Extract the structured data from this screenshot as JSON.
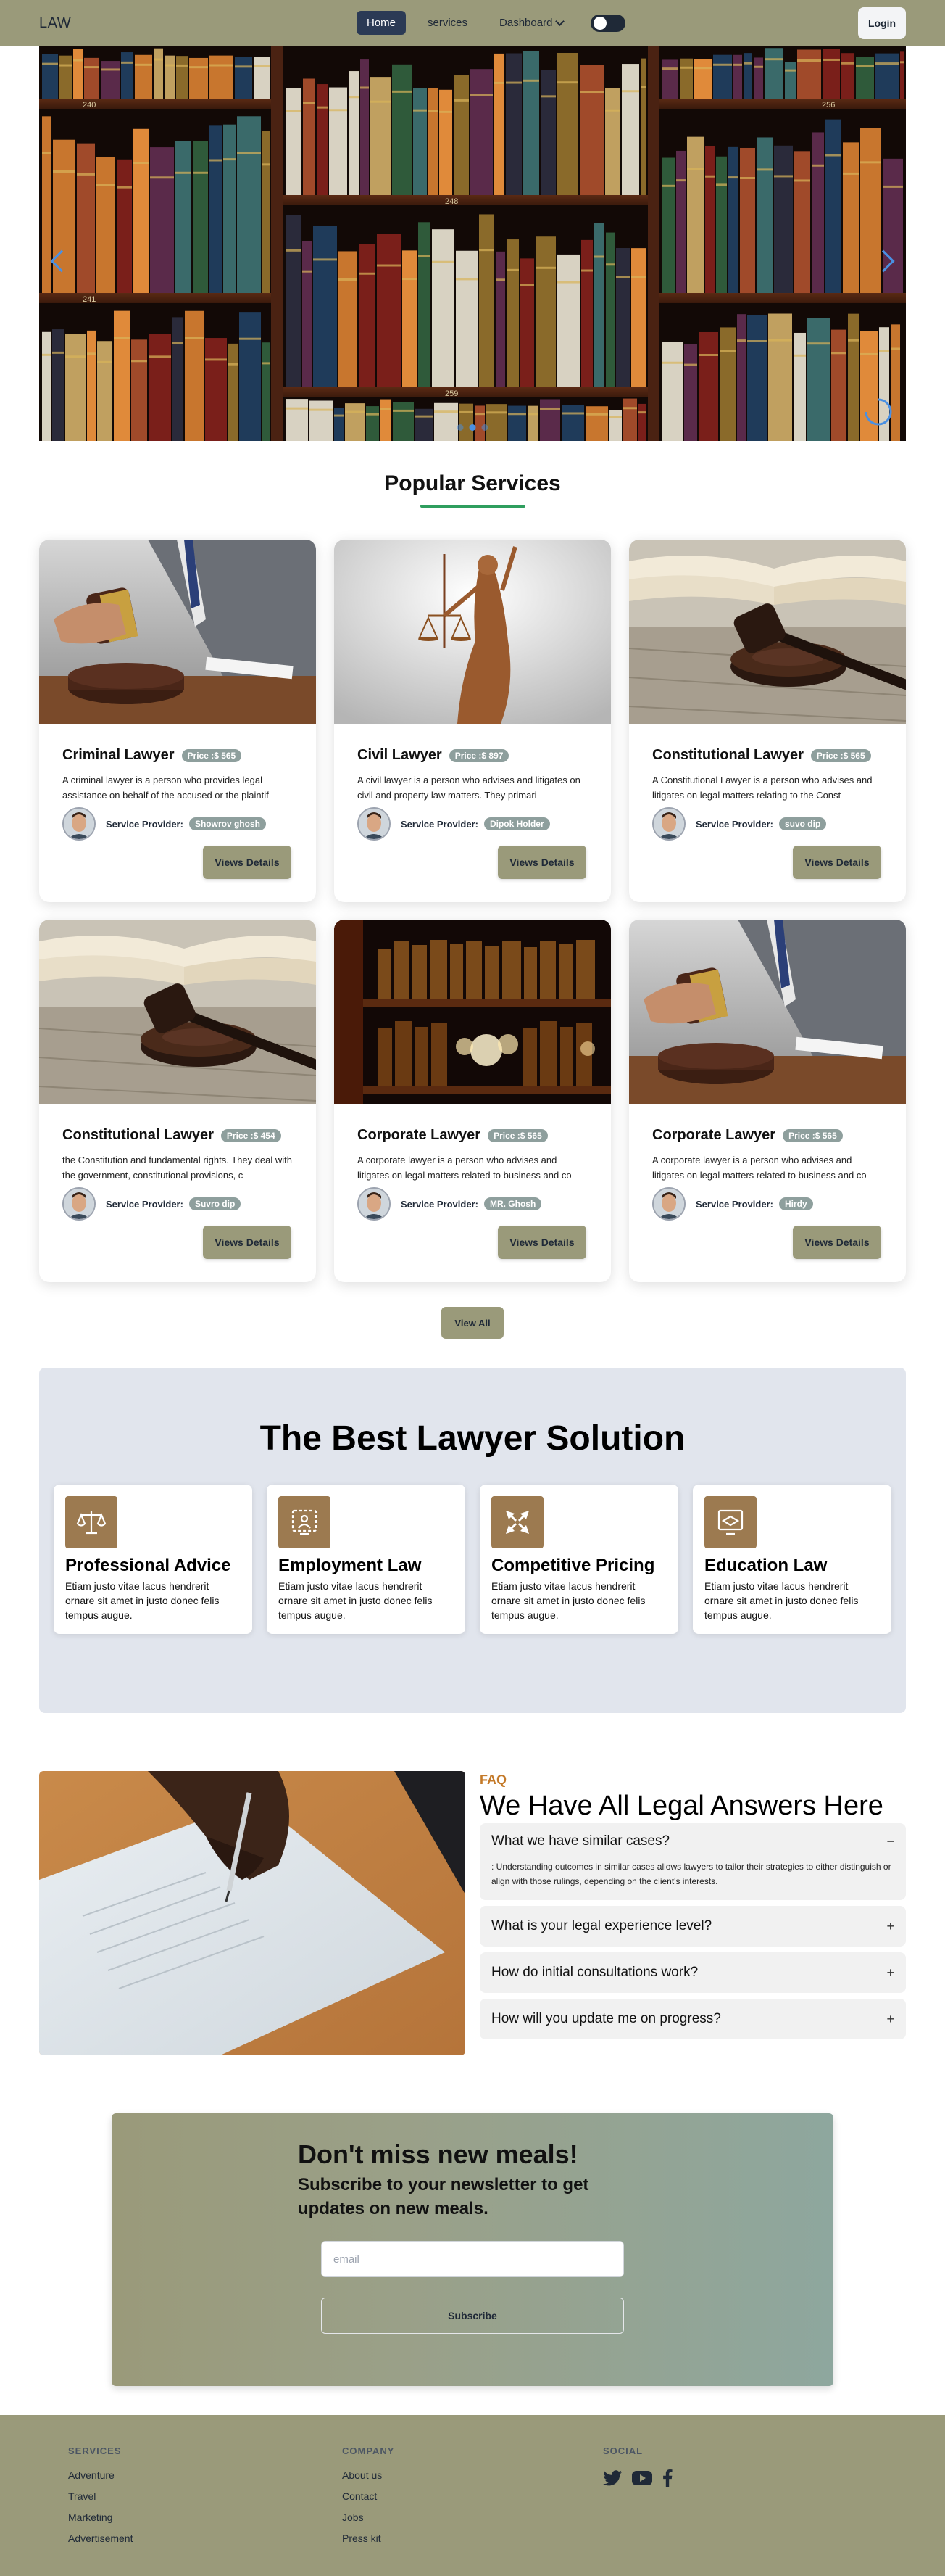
{
  "nav": {
    "brand": "LAW",
    "links": [
      "Home",
      "services"
    ],
    "dropdown": "Dashboard",
    "login": "Login"
  },
  "hero": {
    "shelf_labels": [
      "240",
      "241",
      "248",
      "256",
      "259"
    ],
    "slide_count": 3,
    "active_slide": 2
  },
  "popular": {
    "title": "Popular Services",
    "provider_label": "Service Provider:",
    "button": "Views Details",
    "cards": [
      {
        "title": "Criminal Lawyer",
        "price": "Price :$ 565",
        "desc": "A criminal lawyer is a person who provides legal assistance on behalf of the accused or the plaintif",
        "provider": "Showrov ghosh",
        "image": "gavel-hand"
      },
      {
        "title": "Civil Lawyer",
        "price": "Price :$ 897",
        "desc": "A civil lawyer is a person who advises and litigates on civil and property law matters. They primari",
        "provider": "Dipok Holder",
        "image": "lady-justice"
      },
      {
        "title": "Constitutional Lawyer",
        "price": "Price :$ 565",
        "desc": "A Constitutional Lawyer is a person who advises and litigates on legal matters relating to the Const",
        "provider": "suvo dip",
        "image": "gavel-books"
      },
      {
        "title": "Constitutional Lawyer",
        "price": "Price :$ 454",
        "desc": "the Constitution and fundamental rights. They deal with the government, constitutional provisions, c",
        "provider": "Suvro dip",
        "image": "gavel-books"
      },
      {
        "title": "Corporate Lawyer",
        "price": "Price :$ 565",
        "desc": "A corporate lawyer is a person who advises and litigates on legal matters related to business and co",
        "provider": "MR. Ghosh",
        "image": "bookshelf"
      },
      {
        "title": "Corporate Lawyer",
        "price": "Price :$ 565",
        "desc": "A corporate lawyer is a person who advises and litigates on legal matters related to business and co",
        "provider": "Hirdy",
        "image": "gavel-hand"
      }
    ],
    "view_all": "View All"
  },
  "best": {
    "title": "The Best Lawyer Solution",
    "features": [
      {
        "title": "Professional Advice",
        "text": "Etiam justo vitae lacus hendrerit ornare sit amet in justo donec felis tempus augue.",
        "icon": "scales-icon"
      },
      {
        "title": "Employment Law",
        "text": "Etiam justo vitae lacus hendrerit ornare sit amet in justo donec felis tempus augue.",
        "icon": "employment-icon"
      },
      {
        "title": "Competitive Pricing",
        "text": "Etiam justo vitae lacus hendrerit ornare sit amet in justo donec felis tempus augue.",
        "icon": "pricing-icon"
      },
      {
        "title": "Education Law",
        "text": "Etiam justo vitae lacus hendrerit ornare sit amet in justo donec felis tempus augue.",
        "icon": "education-icon"
      }
    ]
  },
  "faq": {
    "kicker": "FAQ",
    "title": "We Have All Legal Answers Here",
    "items": [
      {
        "q": "What we have similar cases?",
        "sign": "−",
        "answer": ": Understanding outcomes in similar cases allows lawyers to tailor their strategies to either distinguish or align with those rulings, depending on the client's interests."
      },
      {
        "q": "What is your legal experience level?",
        "sign": "+"
      },
      {
        "q": "How do initial consultations work?",
        "sign": "+"
      },
      {
        "q": "How will you update me on progress?",
        "sign": "+"
      }
    ]
  },
  "newsletter": {
    "title": "Don't miss new meals!",
    "subtitle": "Subscribe to your newsletter to get updates on new meals.",
    "placeholder": "email",
    "button": "Subscribe"
  },
  "footer": {
    "services": {
      "heading": "SERVICES",
      "links": [
        "Adventure",
        "Travel",
        "Marketing",
        "Advertisement"
      ]
    },
    "company": {
      "heading": "COMPANY",
      "links": [
        "About us",
        "Contact",
        "Jobs",
        "Press kit"
      ]
    },
    "social": {
      "heading": "SOCIAL",
      "icons": [
        "twitter-icon",
        "youtube-icon",
        "facebook-icon"
      ]
    }
  },
  "colors": {
    "olive": "#9a9a7a",
    "navy": "#2b3a55",
    "badge": "#8e9f9d",
    "accent_green": "#2f9e5e",
    "feature_icon_bg": "#9c7a50",
    "faq_kicker": "#c47a2a"
  }
}
